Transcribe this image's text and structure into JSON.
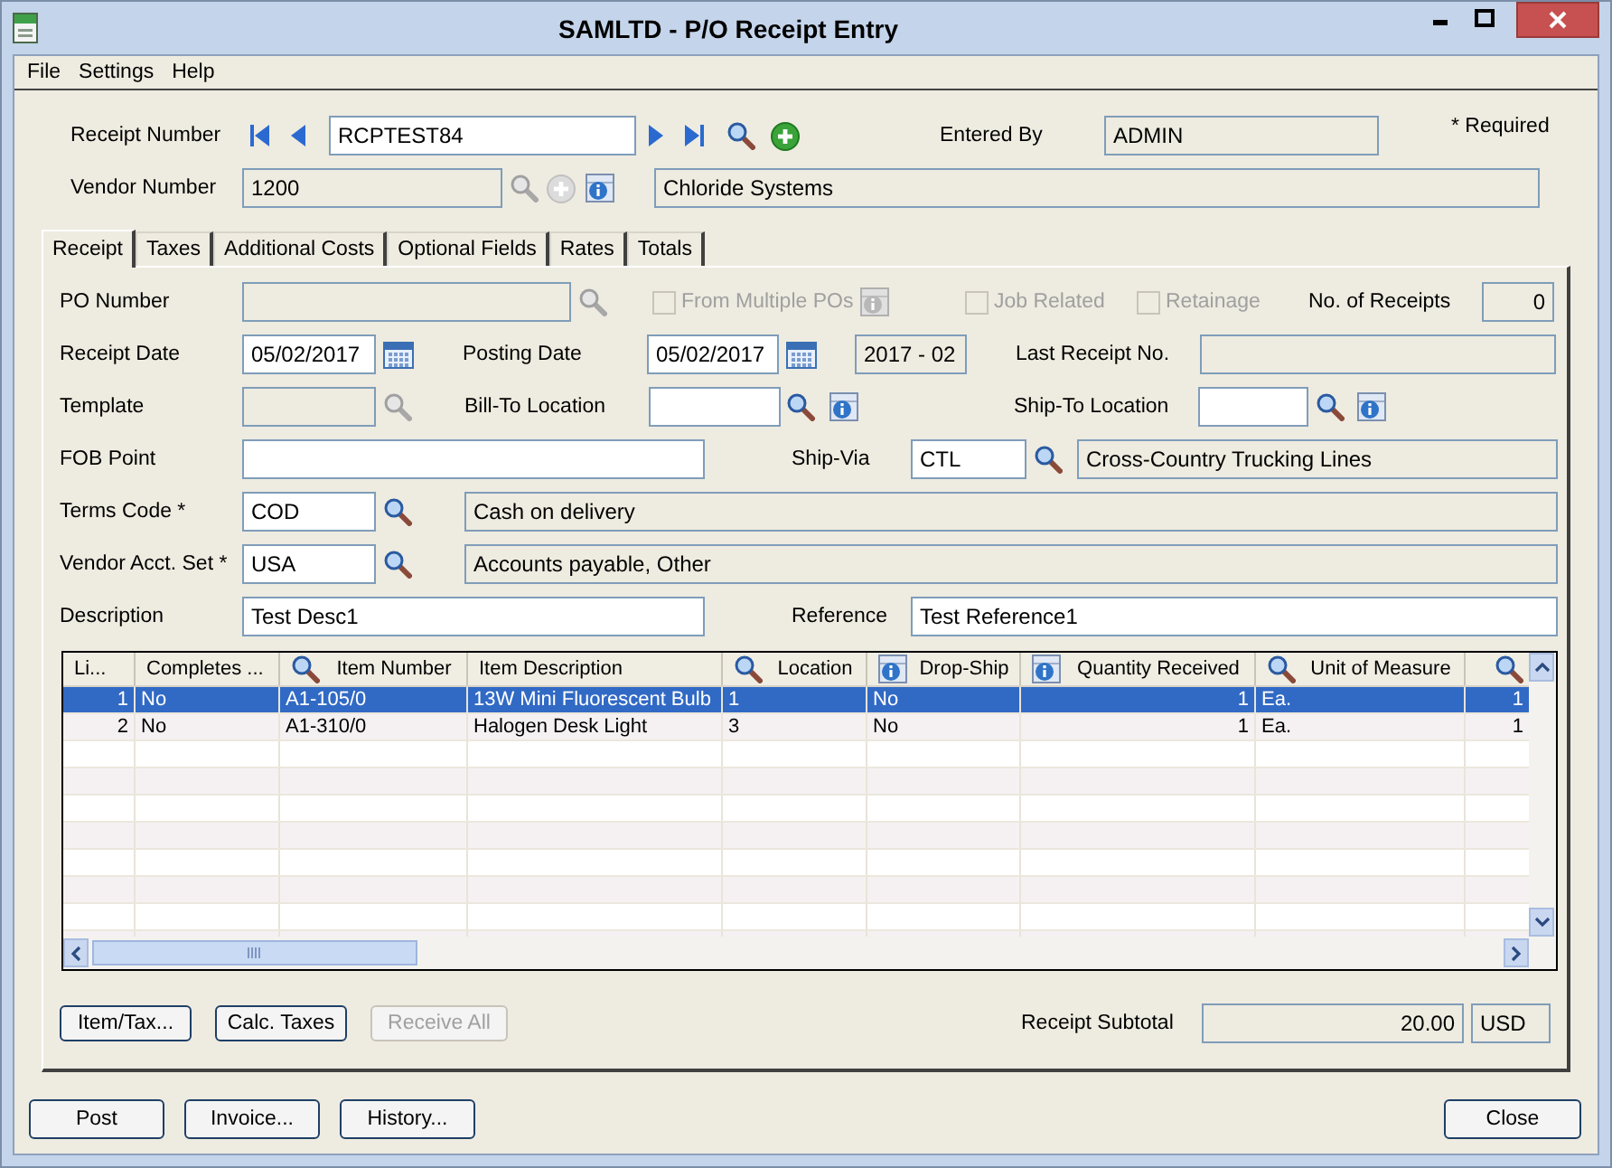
{
  "window": {
    "title": "SAMLTD - P/O Receipt Entry"
  },
  "menu": [
    "File",
    "Settings",
    "Help"
  ],
  "header": {
    "receipt_number": {
      "label": "Receipt Number",
      "value": "RCPTEST84"
    },
    "entered_by": {
      "label": "Entered By",
      "value": "ADMIN"
    },
    "required_note": "* Required",
    "vendor_number": {
      "label": "Vendor Number",
      "value": "1200",
      "name": "Chloride Systems"
    }
  },
  "tabs": [
    {
      "label": "Receipt",
      "selected": true
    },
    {
      "label": "Taxes",
      "selected": false
    },
    {
      "label": "Additional Costs",
      "selected": false
    },
    {
      "label": "Optional Fields",
      "selected": false
    },
    {
      "label": "Rates",
      "selected": false
    },
    {
      "label": "Totals",
      "selected": false
    }
  ],
  "receipt": {
    "po_number": {
      "label": "PO Number",
      "disabled": true
    },
    "options": [
      {
        "label": "From Multiple POs",
        "checked": false,
        "disabled": true
      },
      {
        "label": "Job Related",
        "checked": false,
        "disabled": true
      },
      {
        "label": "Retainage",
        "checked": false,
        "disabled": true
      }
    ],
    "receipts_count": {
      "label": "No. of Receipts",
      "value": "0"
    },
    "receipt_date": {
      "label": "Receipt Date",
      "value": "05/02/2017"
    },
    "posting_date": {
      "label": "Posting Date",
      "value": "05/02/2017",
      "period": "2017 - 02"
    },
    "last_receipt": {
      "label": "Last Receipt No."
    },
    "template": {
      "label": "Template",
      "disabled": true
    },
    "bill_to": {
      "label": "Bill-To Location"
    },
    "ship_to": {
      "label": "Ship-To Location"
    },
    "fob_point": {
      "label": "FOB Point"
    },
    "ship_via": {
      "label": "Ship-Via",
      "value": "CTL",
      "name": "Cross-Country Trucking Lines"
    },
    "terms_code": {
      "label": "Terms Code *",
      "value": "COD",
      "name": "Cash on delivery"
    },
    "vendor_acct_set": {
      "label": "Vendor Acct. Set *",
      "value": "USA",
      "name": "Accounts payable, Other"
    },
    "description": {
      "label": "Description",
      "value": "Test Desc1"
    },
    "reference": {
      "label": "Reference",
      "value": "Test Reference1"
    }
  },
  "grid": {
    "columns": [
      {
        "label": "Li...",
        "kind": "plain"
      },
      {
        "label": "Completes ...",
        "kind": "plain"
      },
      {
        "label": "Item Number",
        "kind": "lookup"
      },
      {
        "label": "Item Description",
        "kind": "plain"
      },
      {
        "label": "Location",
        "kind": "lookup"
      },
      {
        "label": "Drop-Ship",
        "kind": "detail"
      },
      {
        "label": "Quantity Received",
        "kind": "detail"
      },
      {
        "label": "Unit of Measure",
        "kind": "lookup"
      },
      {
        "kind": "lookup"
      }
    ],
    "rows": [
      {
        "cells": [
          "1",
          "No",
          "A1-105/0",
          "13W Mini Fluorescent Bulb",
          "1",
          "No",
          "1",
          "Ea.",
          "1"
        ],
        "selected": true
      },
      {
        "cells": [
          "2",
          "No",
          "A1-310/0",
          "Halogen Desk Light",
          "3",
          "No",
          "1",
          "Ea.",
          "1"
        ],
        "selected": false
      }
    ]
  },
  "actions": [
    {
      "label": "Item/Tax...",
      "disabled": false
    },
    {
      "label": "Calc. Taxes",
      "disabled": false
    },
    {
      "label": "Receive All",
      "disabled": true
    }
  ],
  "subtotal": {
    "label": "Receipt Subtotal",
    "value": "20.00",
    "currency": "USD"
  },
  "footer_buttons": [
    "Post",
    "Invoice...",
    "History..."
  ],
  "close_button": "Close"
}
